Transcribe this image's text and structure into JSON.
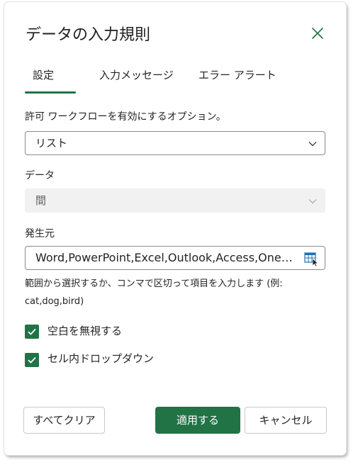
{
  "dialog": {
    "title": "データの入力規則",
    "close_icon": "close-icon"
  },
  "tabs": [
    {
      "label": "設定",
      "selected": true
    },
    {
      "label": "入力メッセージ",
      "selected": false
    },
    {
      "label": "エラー アラート",
      "selected": false
    }
  ],
  "settings": {
    "allow_label": "許可 ワークフローを有効にするオプション。",
    "allow_value": "リスト",
    "data_label": "データ",
    "data_value": "間",
    "source_label": "発生元",
    "source_value": "Word,PowerPoint,Excel,Outlook,Access,OneNote",
    "hint_line1": "範囲から選択するか、コンマで区切って項目を入力します (例:",
    "hint_line2": "cat,dog,bird)"
  },
  "checkboxes": [
    {
      "label": "空白を無視する",
      "checked": true
    },
    {
      "label": "セル内ドロップダウン",
      "checked": true
    }
  ],
  "buttons": {
    "clear": "すべてクリア",
    "apply": "適用する",
    "cancel": "キャンセル"
  },
  "colors": {
    "accent": "#217346",
    "text": "#242424",
    "disabled_bg": "#f1f1f1"
  }
}
